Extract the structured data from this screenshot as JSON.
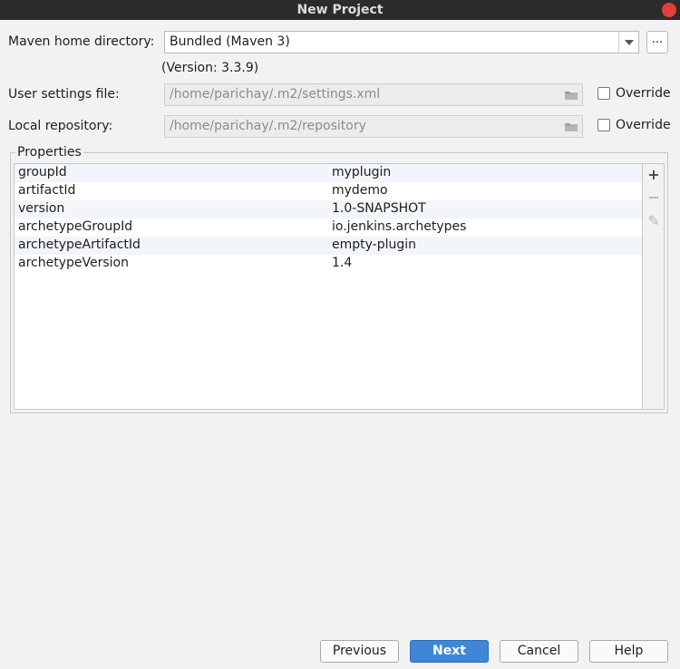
{
  "window": {
    "title": "New Project"
  },
  "maven_home": {
    "label": "Maven home directory:",
    "value": "Bundled (Maven 3)",
    "version": "(Version: 3.3.9)",
    "browse_label": "..."
  },
  "user_settings": {
    "label": "User settings file:",
    "value": "/home/parichay/.m2/settings.xml",
    "override_label": "Override",
    "override_checked": false
  },
  "local_repository": {
    "label": "Local repository:",
    "value": "/home/parichay/.m2/repository",
    "override_label": "Override",
    "override_checked": false
  },
  "properties": {
    "legend": "Properties",
    "rows": [
      {
        "key": "groupId",
        "value": "myplugin"
      },
      {
        "key": "artifactId",
        "value": "mydemo"
      },
      {
        "key": "version",
        "value": "1.0-SNAPSHOT"
      },
      {
        "key": "archetypeGroupId",
        "value": "io.jenkins.archetypes"
      },
      {
        "key": "archetypeArtifactId",
        "value": "empty-plugin"
      },
      {
        "key": "archetypeVersion",
        "value": "1.4"
      }
    ],
    "tools": {
      "add_icon": "+",
      "remove_icon": "−",
      "edit_icon": "✎"
    }
  },
  "buttons": {
    "previous": "Previous",
    "next": "Next",
    "cancel": "Cancel",
    "help": "Help"
  },
  "colors": {
    "primary_button": "#3f87d6",
    "close_button": "#e0403a",
    "titlebar": "#2b2b2b"
  }
}
